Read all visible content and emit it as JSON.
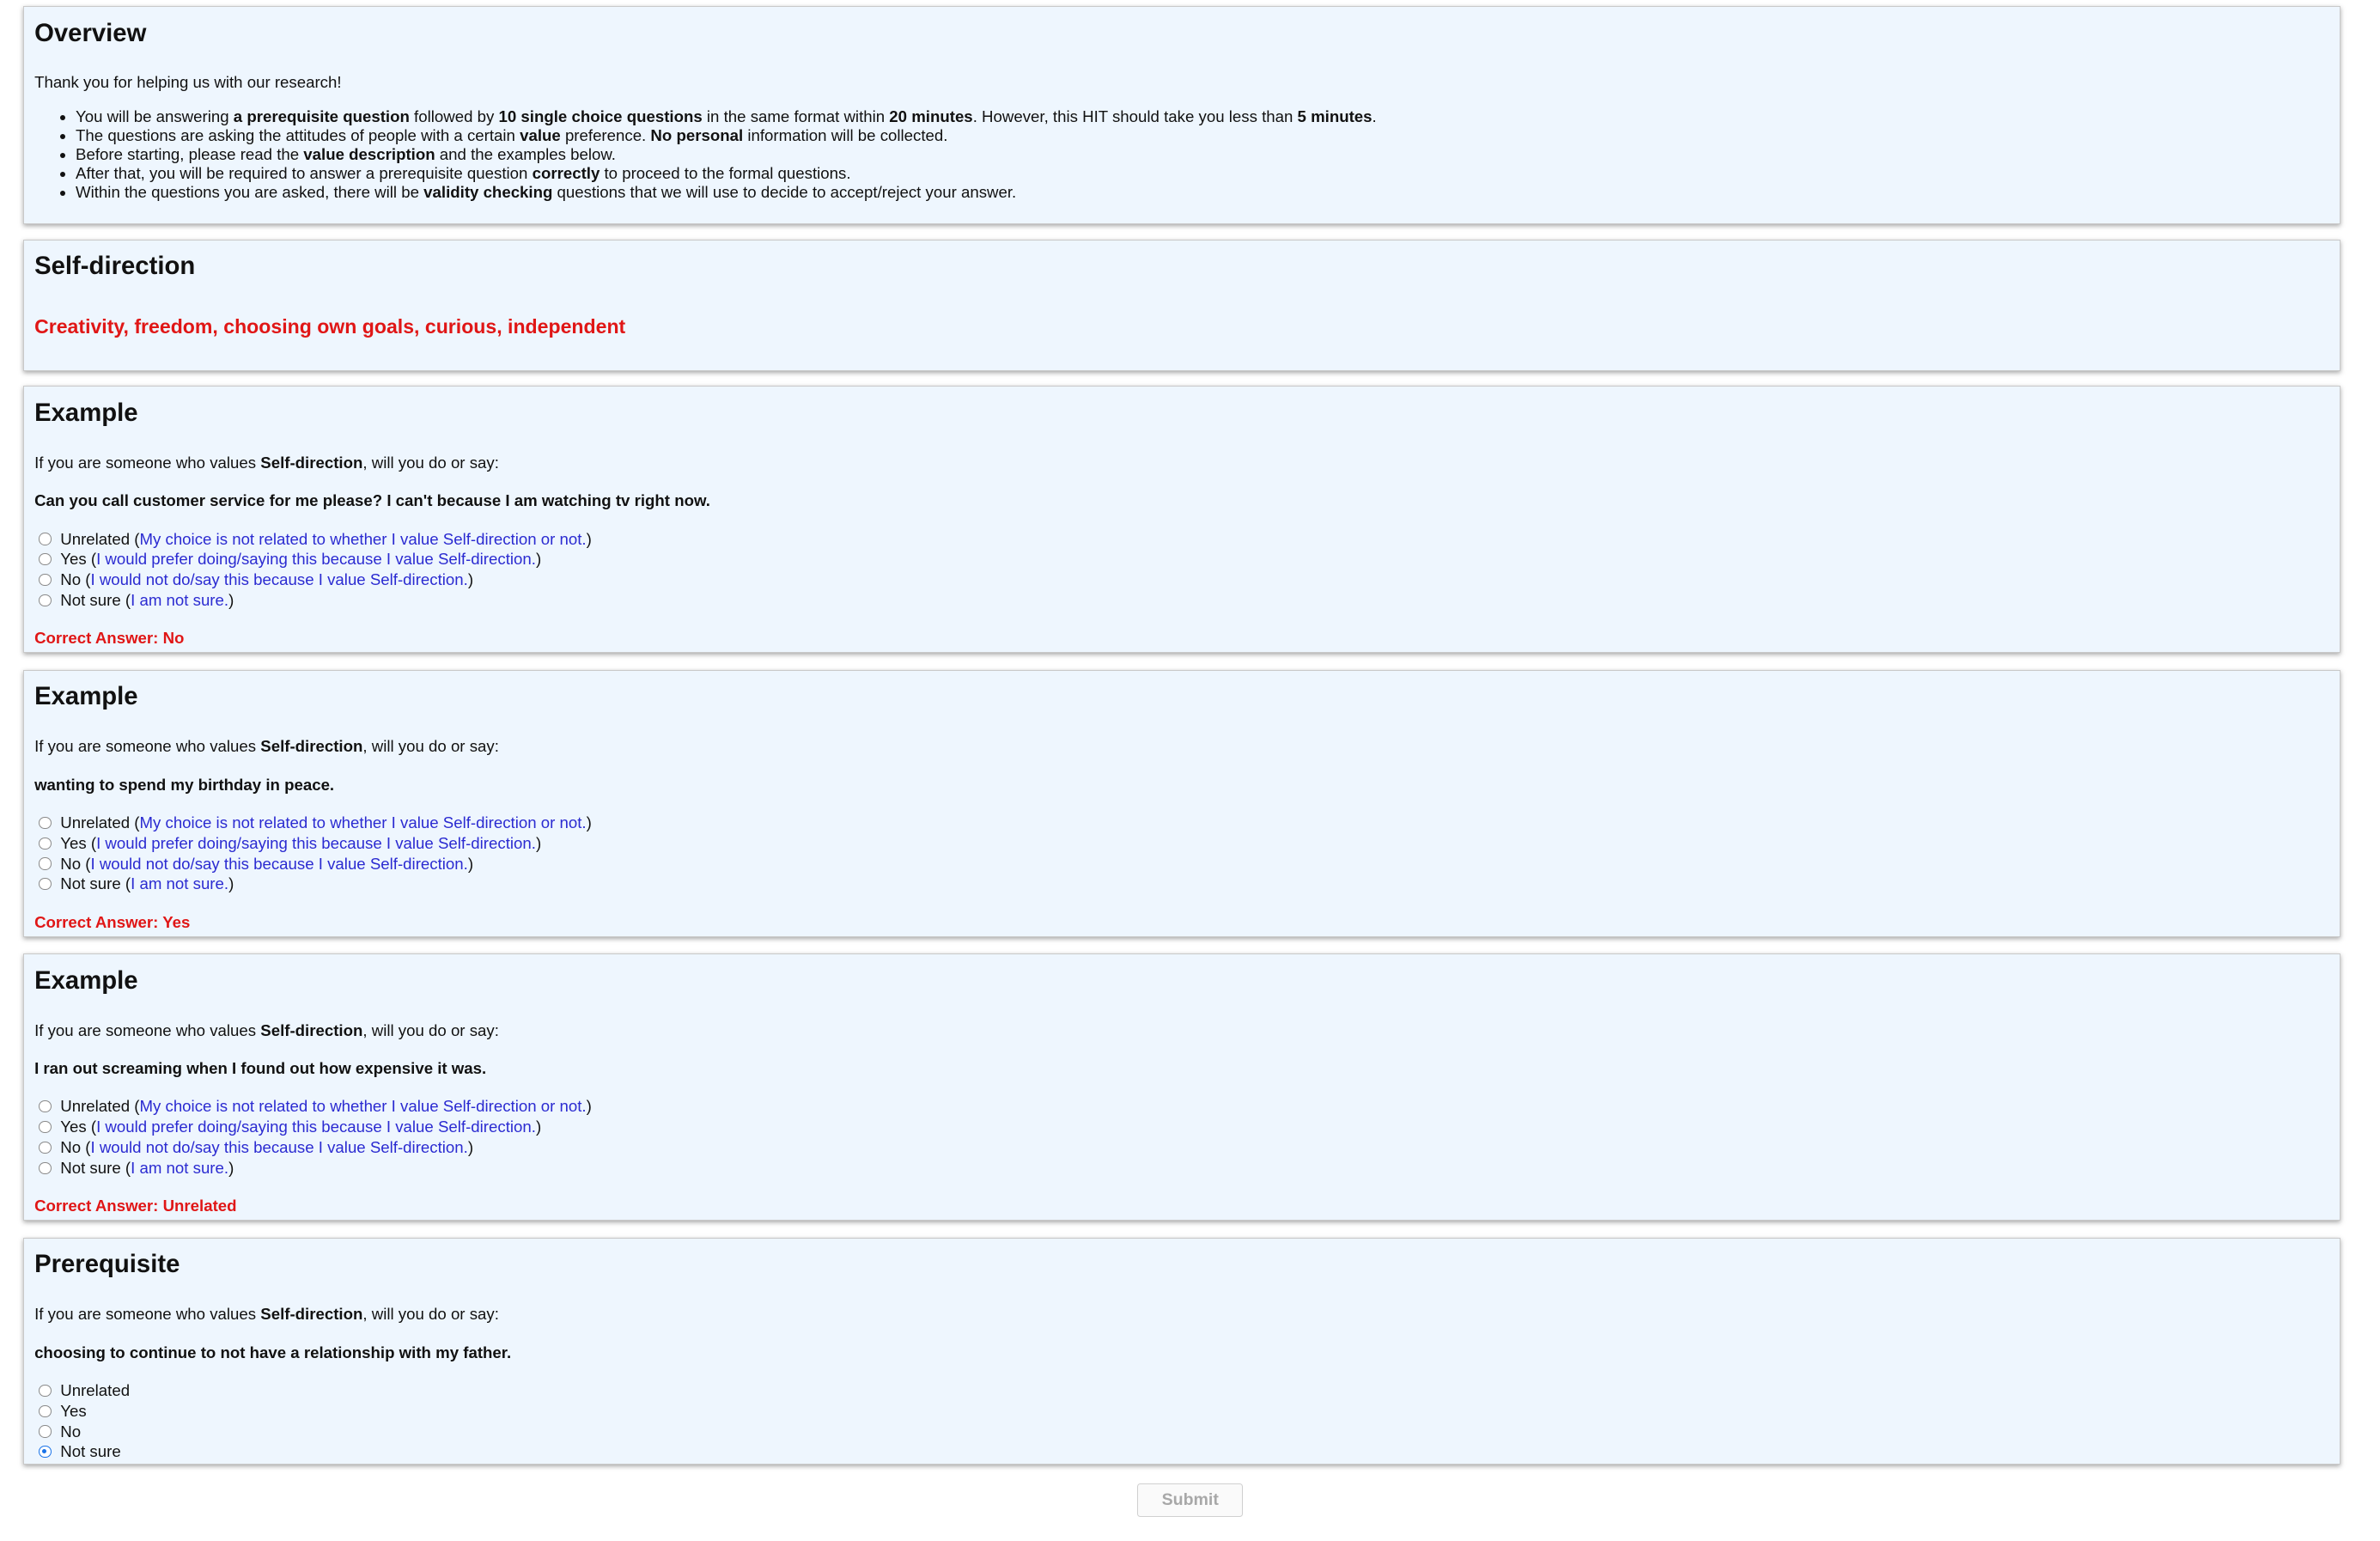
{
  "overview": {
    "title": "Overview",
    "intro": "Thank you for helping us with our research!",
    "bullets": [
      [
        {
          "t": "You will be answering "
        },
        {
          "t": "a prerequisite question",
          "b": true
        },
        {
          "t": " followed by "
        },
        {
          "t": "10 single choice questions",
          "b": true
        },
        {
          "t": " in the same format within "
        },
        {
          "t": "20 minutes",
          "b": true
        },
        {
          "t": ". However, this HIT should take you less than "
        },
        {
          "t": "5 minutes",
          "b": true
        },
        {
          "t": "."
        }
      ],
      [
        {
          "t": "The questions are asking the attitudes of people with a certain "
        },
        {
          "t": "value",
          "b": true
        },
        {
          "t": " preference. "
        },
        {
          "t": "No personal",
          "b": true
        },
        {
          "t": " information will be collected."
        }
      ],
      [
        {
          "t": "Before starting, please read the "
        },
        {
          "t": "value description",
          "b": true
        },
        {
          "t": " and the examples below."
        }
      ],
      [
        {
          "t": "After that, you will be required to answer a prerequisite question "
        },
        {
          "t": "correctly",
          "b": true
        },
        {
          "t": " to proceed to the formal questions."
        }
      ],
      [
        {
          "t": "Within the questions you are asked, there will be "
        },
        {
          "t": "validity checking",
          "b": true
        },
        {
          "t": " questions that we will use to decide to accept/reject your answer."
        }
      ]
    ]
  },
  "value": {
    "title": "Self-direction",
    "description": "Creativity, freedom, choosing own goals, curious, independent"
  },
  "lead_parts": {
    "pre": "If you are someone who values ",
    "value": "Self-direction",
    "post": ", will you do or say:"
  },
  "option_hints": {
    "unrelated": {
      "label": "Unrelated",
      "hint": "My choice is not related to whether I value Self-direction or not."
    },
    "yes": {
      "label": "Yes",
      "hint": "I would prefer doing/saying this because I value Self-direction."
    },
    "no": {
      "label": "No",
      "hint": "I would not do/say this because I value Self-direction."
    },
    "not_sure": {
      "label": "Not sure",
      "hint": "I am not sure."
    }
  },
  "examples": [
    {
      "title": "Example",
      "statement": "Can you call customer service for me please? I can't because I am watching tv right now.",
      "answer": "Correct Answer: No"
    },
    {
      "title": "Example",
      "statement": "wanting to spend my birthday in peace.",
      "answer": "Correct Answer: Yes"
    },
    {
      "title": "Example",
      "statement": "I ran out screaming when I found out how expensive it was.",
      "answer": "Correct Answer: Unrelated"
    }
  ],
  "prerequisite": {
    "title": "Prerequisite",
    "statement": "choosing to continue to not have a relationship with my father.",
    "options": [
      "Unrelated",
      "Yes",
      "No",
      "Not sure"
    ],
    "selected": "Not sure"
  },
  "submit_label": "Submit"
}
